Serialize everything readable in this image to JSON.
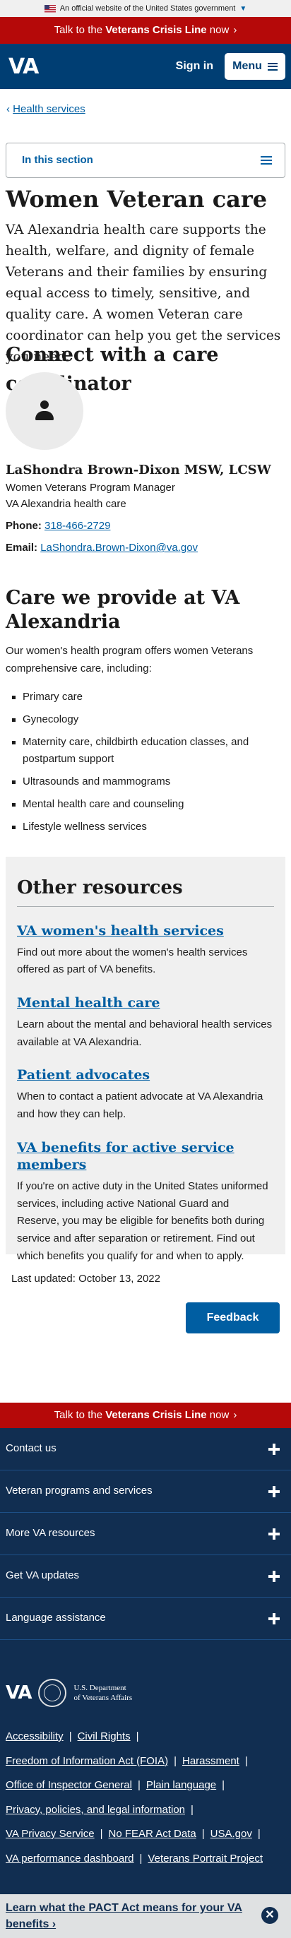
{
  "gov_banner": {
    "text": "An official website of the United States government",
    "chevron": "chevron-down-icon"
  },
  "crisis_line": {
    "pre": "Talk to the ",
    "strong": "Veterans Crisis Line",
    "post": " now",
    "chevron": "chevron-right-icon"
  },
  "header": {
    "logo": "VA",
    "sign_in": "Sign in",
    "menu": "Menu"
  },
  "breadcrumb": {
    "back": "Health services"
  },
  "section_nav": {
    "label": "In this section"
  },
  "page": {
    "title": "Women Veteran care",
    "lead": "VA Alexandria health care supports the health, welfare, and dignity of female Veterans and their families by ensuring equal access to timely, sensitive, and quality care. A women Veteran care coordinator can help you get the services you need."
  },
  "coordinator": {
    "heading": "Connect with a care coordinator",
    "name": "LaShondra Brown-Dixon MSW, LCSW",
    "title": "Women Veterans Program Manager",
    "org": "VA Alexandria health care",
    "phone_label": "Phone:",
    "phone": "318-466-2729",
    "email_label": "Email:",
    "email": "LaShondra.Brown-Dixon@va.gov"
  },
  "care": {
    "heading": "Care we provide at VA Alexandria",
    "intro": "Our women's health program offers women Veterans comprehensive care, including:",
    "items": [
      "Primary care",
      "Gynecology",
      "Maternity care, childbirth education classes, and postpartum support",
      "Ultrasounds and mammograms",
      "Mental health care and counseling",
      "Lifestyle wellness services"
    ]
  },
  "other_resources": {
    "heading": "Other resources",
    "items": [
      {
        "title": "VA women's health services",
        "desc": "Find out more about the women's health services offered as part of VA benefits."
      },
      {
        "title": "Mental health care",
        "desc": "Learn about the mental and behavioral health services available at VA Alexandria."
      },
      {
        "title": "Patient advocates",
        "desc": "When to contact a patient advocate at VA Alexandria and how they can help."
      },
      {
        "title": "VA benefits for active service members",
        "desc": "If you're on active duty in the United States uniformed services, including active National Guard and Reserve, you may be eligible for benefits both during service and after separation or retirement. Find out which benefits you qualify for and when to apply."
      }
    ]
  },
  "last_updated": "Last updated: October 13, 2022",
  "feedback": "Feedback",
  "footer": {
    "sections": [
      "Contact us",
      "Veteran programs and services",
      "More VA resources",
      "Get VA updates",
      "Language assistance"
    ],
    "logo": "VA",
    "dept_line1": "U.S. Department",
    "dept_line2": "of Veterans Affairs",
    "links": [
      [
        "Accessibility",
        "Civil Rights"
      ],
      [
        "Freedom of Information Act (FOIA)",
        "Harassment"
      ],
      [
        "Office of Inspector General",
        "Plain language"
      ],
      [
        "Privacy, policies, and legal information"
      ],
      [
        "VA Privacy Service",
        "No FEAR Act Data",
        "USA.gov"
      ],
      [
        "VA performance dashboard",
        "Veterans Portrait Project"
      ]
    ]
  },
  "pact_banner": {
    "text": "Learn what the PACT Act means for your VA benefits",
    "close": "close-icon"
  }
}
